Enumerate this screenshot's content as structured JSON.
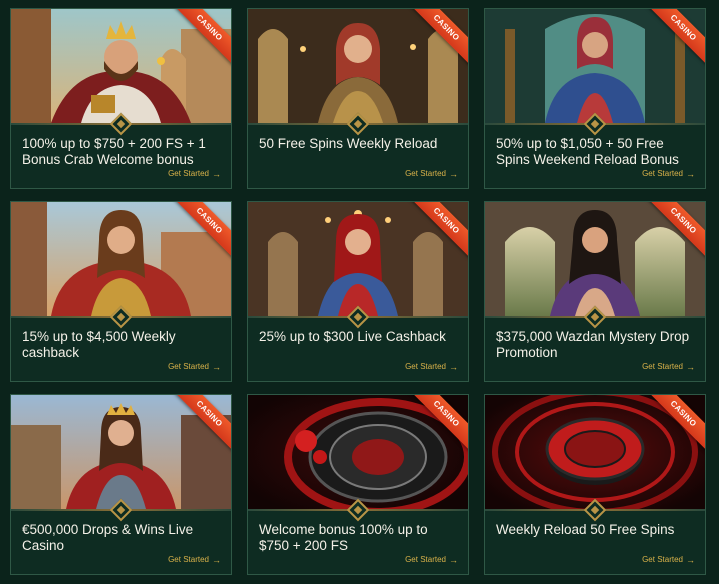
{
  "colors": {
    "background": "#0b231b",
    "card": "#0e2c22",
    "accent_gold": "#d9b24a",
    "ribbon": "#ea4a22",
    "title_text": "#f4f1e8"
  },
  "cards": [
    {
      "badge": "CASINO",
      "title": "100% up to $750 + 200 FS + 1 Bonus Crab Welcome bonus",
      "cta": "Get Started",
      "cta_icon": "arrow-right-icon"
    },
    {
      "badge": "CASINO",
      "title": "50 Free Spins Weekly Reload",
      "cta": "Get Started",
      "cta_icon": "arrow-right-icon"
    },
    {
      "badge": "CASINO",
      "title": "50% up to $1,050 + 50 Free Spins Weekend Reload Bonus",
      "cta": "Get Started",
      "cta_icon": "arrow-right-icon"
    },
    {
      "badge": "CASINO",
      "title": "15% up to $4,500 Weekly cashback",
      "cta": "Get Started",
      "cta_icon": "arrow-right-icon"
    },
    {
      "badge": "CASINO",
      "title": "25% up to $300 Live Cashback",
      "cta": "Get Started",
      "cta_icon": "arrow-right-icon"
    },
    {
      "badge": "CASINO",
      "title": "$375,000 Wazdan Mystery Drop Promotion",
      "cta": "Get Started",
      "cta_icon": "arrow-right-icon"
    },
    {
      "badge": "CASINO",
      "title": "€500,000 Drops & Wins Live Casino",
      "cta": "Get Started",
      "cta_icon": "arrow-right-icon"
    },
    {
      "badge": "CASINO",
      "title": "Welcome bonus 100% up to $750 + 200 FS",
      "cta": "Get Started",
      "cta_icon": "arrow-right-icon"
    },
    {
      "badge": "CASINO",
      "title": "Weekly Reload 50 Free Spins",
      "cta": "Get Started",
      "cta_icon": "arrow-right-icon"
    }
  ]
}
